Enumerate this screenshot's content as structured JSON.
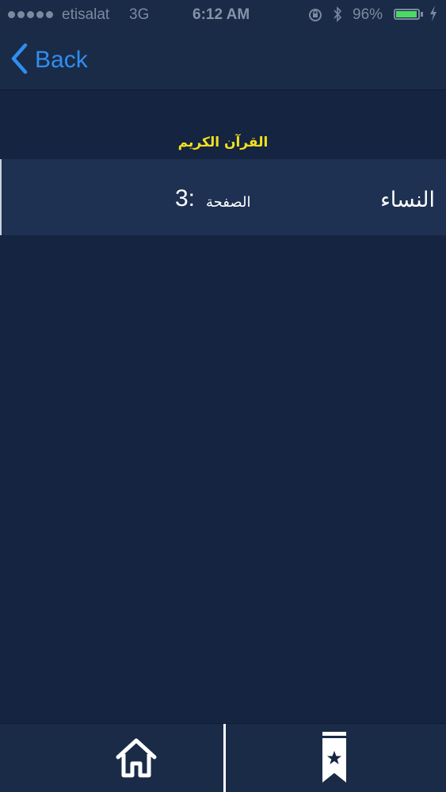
{
  "status_bar": {
    "carrier": "etisalat",
    "network": "3G",
    "time": "6:12 AM",
    "battery_percent": "96%",
    "battery_level": 0.96,
    "battery_color": "#4cd964",
    "icons": [
      "signal-dots",
      "rotation-lock-icon",
      "bluetooth-icon",
      "battery-icon",
      "charging-icon"
    ]
  },
  "nav": {
    "back_label": "Back",
    "back_icon": "chevron-left-icon",
    "accent_color": "#2f8ef0"
  },
  "section": {
    "title": "القرآن الكريم",
    "title_color": "#f0e020"
  },
  "bookmarks": [
    {
      "surah": "النساء",
      "page_label": "الصفحة",
      "page_number": ":3"
    }
  ],
  "tab_bar": {
    "tabs": [
      {
        "icon": "home-icon"
      },
      {
        "icon": "bookmark-icon"
      }
    ]
  }
}
